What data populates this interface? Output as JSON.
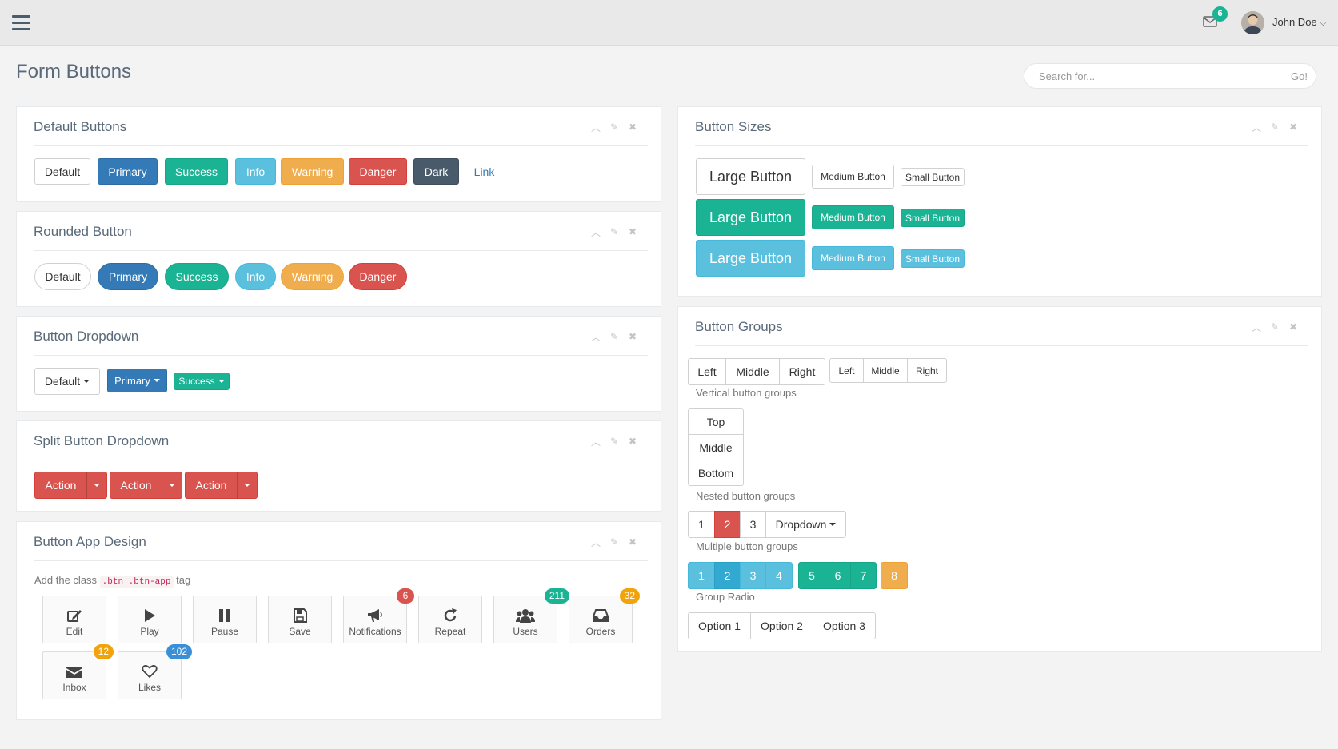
{
  "header": {
    "user_name": "John Doe",
    "mail_count": "6"
  },
  "page": {
    "title": "Form Buttons",
    "search_placeholder": "Search for...",
    "search_go": "Go!"
  },
  "default_buttons": {
    "title": "Default Buttons",
    "buttons": [
      "Default",
      "Primary",
      "Success",
      "Info",
      "Warning",
      "Danger",
      "Dark",
      "Link"
    ]
  },
  "rounded_buttons": {
    "title": "Rounded Button",
    "buttons": [
      "Default",
      "Primary",
      "Success",
      "Info",
      "Warning",
      "Danger"
    ]
  },
  "button_dropdown": {
    "title": "Button Dropdown",
    "buttons": [
      "Default",
      "Primary",
      "Success"
    ]
  },
  "split_dropdown": {
    "title": "Split Button Dropdown",
    "buttons": [
      "Action",
      "Action",
      "Action"
    ]
  },
  "app_design": {
    "title": "Button App Design",
    "hint_prefix": "Add the class",
    "hint_code": ".btn .btn-app",
    "hint_suffix": "tag",
    "apps": [
      {
        "label": "Edit",
        "badge": ""
      },
      {
        "label": "Play",
        "badge": ""
      },
      {
        "label": "Pause",
        "badge": ""
      },
      {
        "label": "Save",
        "badge": ""
      },
      {
        "label": "Notifications",
        "badge": "6"
      },
      {
        "label": "Repeat",
        "badge": ""
      },
      {
        "label": "Users",
        "badge": "211"
      },
      {
        "label": "Orders",
        "badge": "32"
      },
      {
        "label": "Inbox",
        "badge": "12"
      },
      {
        "label": "Likes",
        "badge": "102"
      }
    ]
  },
  "button_sizes": {
    "title": "Button Sizes",
    "large": "Large Button",
    "medium": "Medium Button",
    "small": "Small Button"
  },
  "button_groups": {
    "title": "Button Groups",
    "group1": [
      "Left",
      "Middle",
      "Right"
    ],
    "group2": [
      "Left",
      "Middle",
      "Right"
    ],
    "vertical_label": "Vertical button groups",
    "vertical": [
      "Top",
      "Middle",
      "Bottom"
    ],
    "nested_label": "Nested button groups",
    "nested": [
      "1",
      "2",
      "3",
      "Dropdown"
    ],
    "multiple_label": "Multiple button groups",
    "multiple_a": [
      "1",
      "2",
      "3",
      "4"
    ],
    "multiple_b": [
      "5",
      "6",
      "7"
    ],
    "multiple_c": [
      "8"
    ],
    "radio_label": "Group Radio",
    "radio": [
      "Option 1",
      "Option 2",
      "Option 3"
    ]
  },
  "colors": {
    "primary": "#337ab7",
    "success": "#1ab394",
    "info": "#5bc0de",
    "warning": "#f0ad4e",
    "danger": "#d9534f",
    "dark": "#495a6b"
  }
}
